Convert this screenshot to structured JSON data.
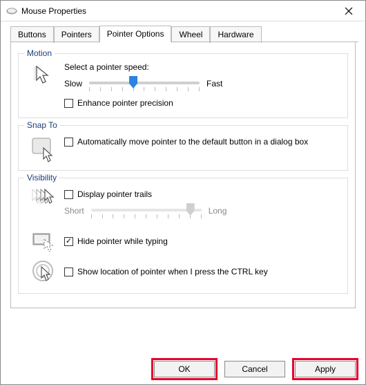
{
  "window": {
    "title": "Mouse Properties"
  },
  "tabs": {
    "items": [
      {
        "label": "Buttons"
      },
      {
        "label": "Pointers"
      },
      {
        "label": "Pointer Options"
      },
      {
        "label": "Wheel"
      },
      {
        "label": "Hardware"
      }
    ],
    "active_index": 2
  },
  "motion": {
    "title": "Motion",
    "heading": "Select a pointer speed:",
    "slow": "Slow",
    "fast": "Fast",
    "enhance_label": "Enhance pointer precision",
    "enhance_checked": false,
    "speed_value": 5,
    "speed_min": 1,
    "speed_max": 11
  },
  "snap": {
    "title": "Snap To",
    "auto_move_label": "Automatically move pointer to the default button in a dialog box",
    "auto_move_checked": false
  },
  "visibility": {
    "title": "Visibility",
    "trails_label": "Display pointer trails",
    "trails_checked": false,
    "short": "Short",
    "long": "Long",
    "trails_value": 10,
    "hide_label": "Hide pointer while typing",
    "hide_checked": true,
    "ctrl_label": "Show location of pointer when I press the CTRL key",
    "ctrl_checked": false
  },
  "buttons": {
    "ok": "OK",
    "cancel": "Cancel",
    "apply": "Apply"
  }
}
